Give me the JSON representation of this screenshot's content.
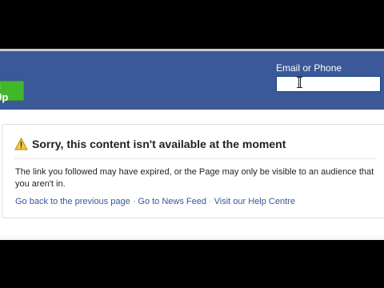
{
  "header": {
    "signup_label": "n Up",
    "email_label": "Email or Phone",
    "email_value": ""
  },
  "error": {
    "title": "Sorry, this content isn't available at the moment",
    "message": "The link you followed may have expired, or the Page may only be visible to an audience that you aren't in.",
    "links": {
      "back": "Go back to the previous page",
      "news_feed": "Go to News Feed",
      "help": "Visit our Help Centre"
    },
    "separator": "·"
  },
  "colors": {
    "brand_blue": "#3b5998",
    "signup_green": "#42b72a",
    "link_blue": "#365899"
  },
  "icons": {
    "warning": "warning-icon",
    "cursor": "text-cursor-icon"
  }
}
